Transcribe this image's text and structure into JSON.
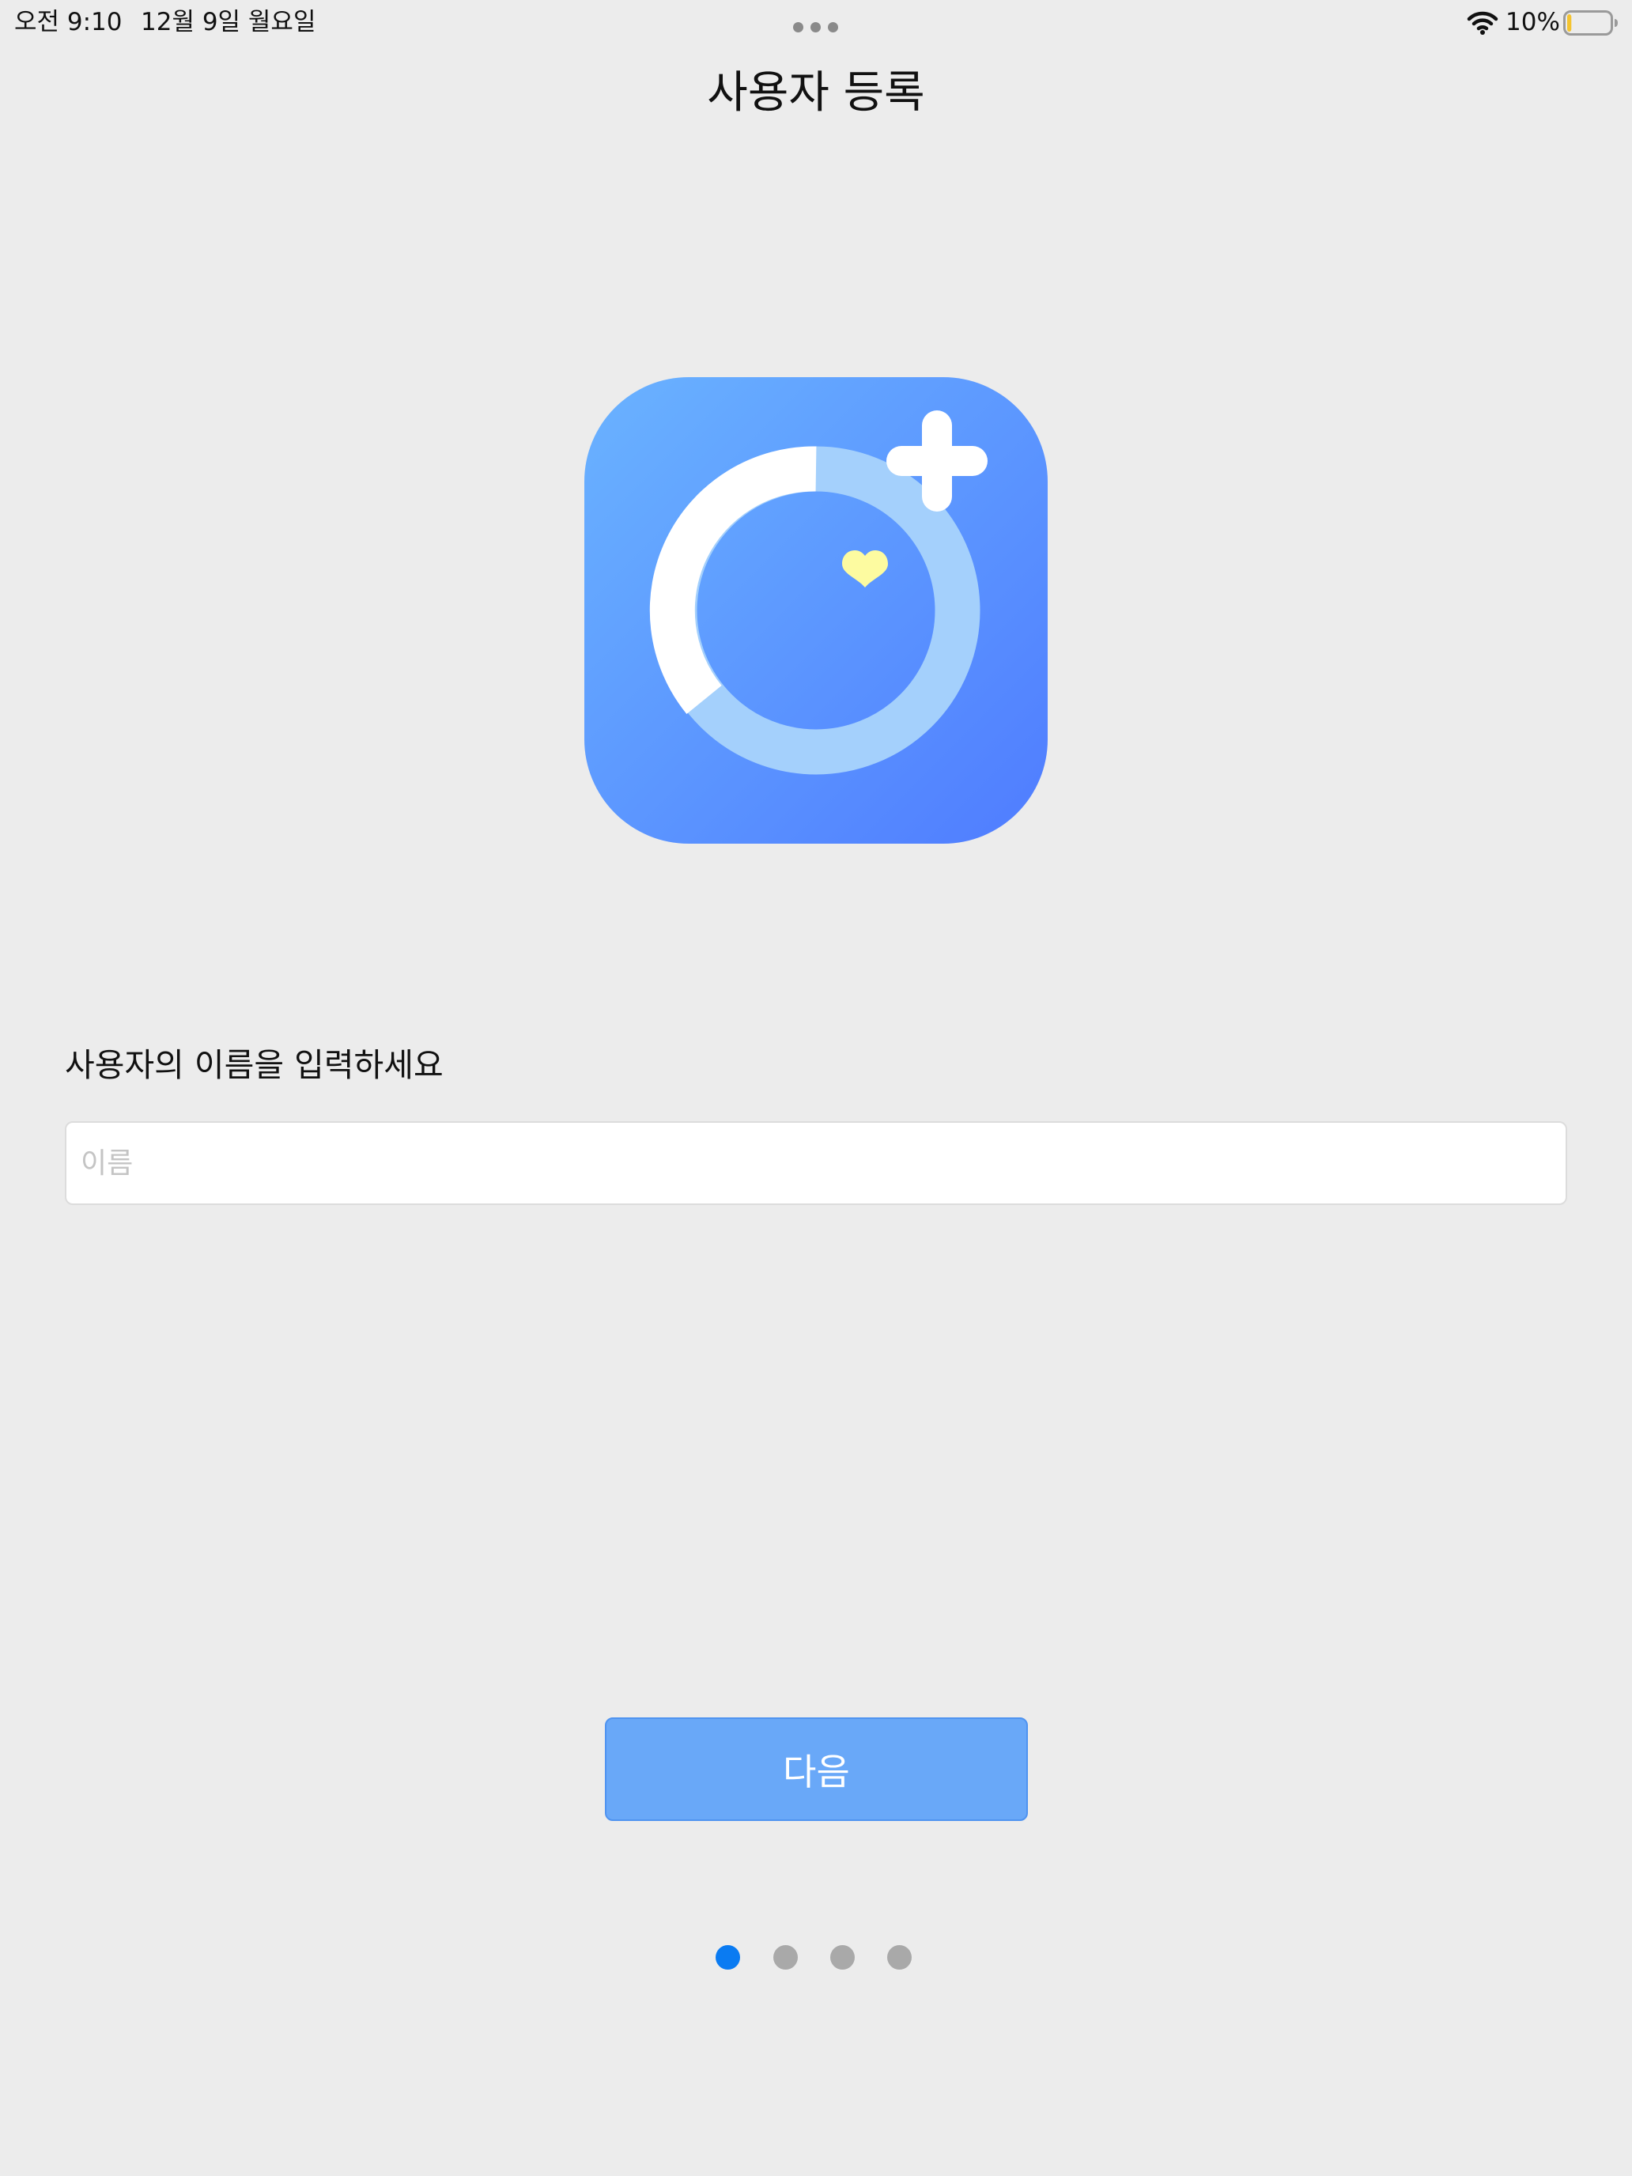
{
  "status_bar": {
    "time": "오전 9:10",
    "date": "12월 9일 월요일",
    "battery_percent": "10%",
    "battery_level": 0.1,
    "icons": [
      "multitasking-dots-icon",
      "wifi-icon",
      "battery-icon"
    ]
  },
  "header": {
    "title": "사용자 등록"
  },
  "app_icon": {
    "icon": "health-ring-plus-heart-icon",
    "colors": {
      "gradient_start": "#6ab3ff",
      "gradient_end": "#4f7cff",
      "ring_light": "#a4d0fc",
      "ring_white": "#ffffff",
      "heart": "#fdfba0"
    }
  },
  "form": {
    "prompt": "사용자의 이름을 입력하세요",
    "name_placeholder": "이름",
    "name_value": ""
  },
  "actions": {
    "next_label": "다음"
  },
  "pager": {
    "page_count": 4,
    "current_page": 1,
    "active_color": "#0a7bf2",
    "inactive_color": "#a9a9a9"
  }
}
